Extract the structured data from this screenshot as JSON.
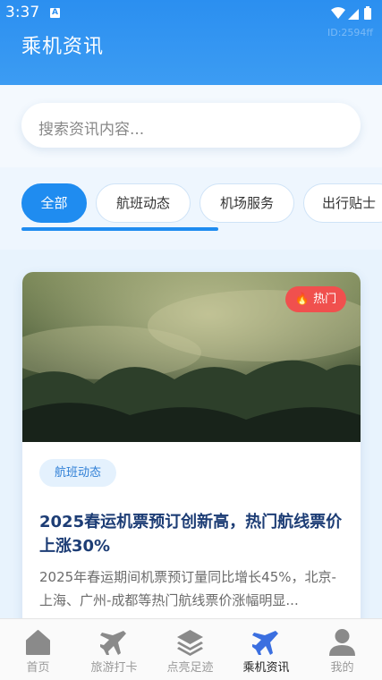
{
  "status_bar": {
    "time": "3:37",
    "notification_glyph": "A"
  },
  "header": {
    "title": "乘机资讯",
    "id_label": "ID:2594ff"
  },
  "search": {
    "placeholder": "搜索资讯内容..."
  },
  "tabs": [
    {
      "label": "全部",
      "active": true
    },
    {
      "label": "航班动态",
      "active": false
    },
    {
      "label": "机场服务",
      "active": false
    },
    {
      "label": "出行贴士",
      "active": false
    }
  ],
  "article": {
    "badge": "热门",
    "category": "航班动态",
    "title": "2025春运机票预订创新高，热门航线票价上涨30%",
    "summary": "2025年春运期间机票预订量同比增长45%，北京-上海、广州-成都等热门航线票价涨幅明显..."
  },
  "nav": [
    {
      "label": "首页",
      "icon": "home-icon",
      "active": false
    },
    {
      "label": "旅游打卡",
      "icon": "plane-icon",
      "active": false
    },
    {
      "label": "点亮足迹",
      "icon": "layers-icon",
      "active": false
    },
    {
      "label": "乘机资讯",
      "icon": "plane-icon",
      "active": true
    },
    {
      "label": "我的",
      "icon": "user-icon",
      "active": false
    }
  ],
  "colors": {
    "accent": "#1f8cf0",
    "hot": "#f0504e",
    "title": "#1d3d75",
    "nav_active": "#3b6fe0",
    "nav_inactive": "#9a9a9a"
  }
}
